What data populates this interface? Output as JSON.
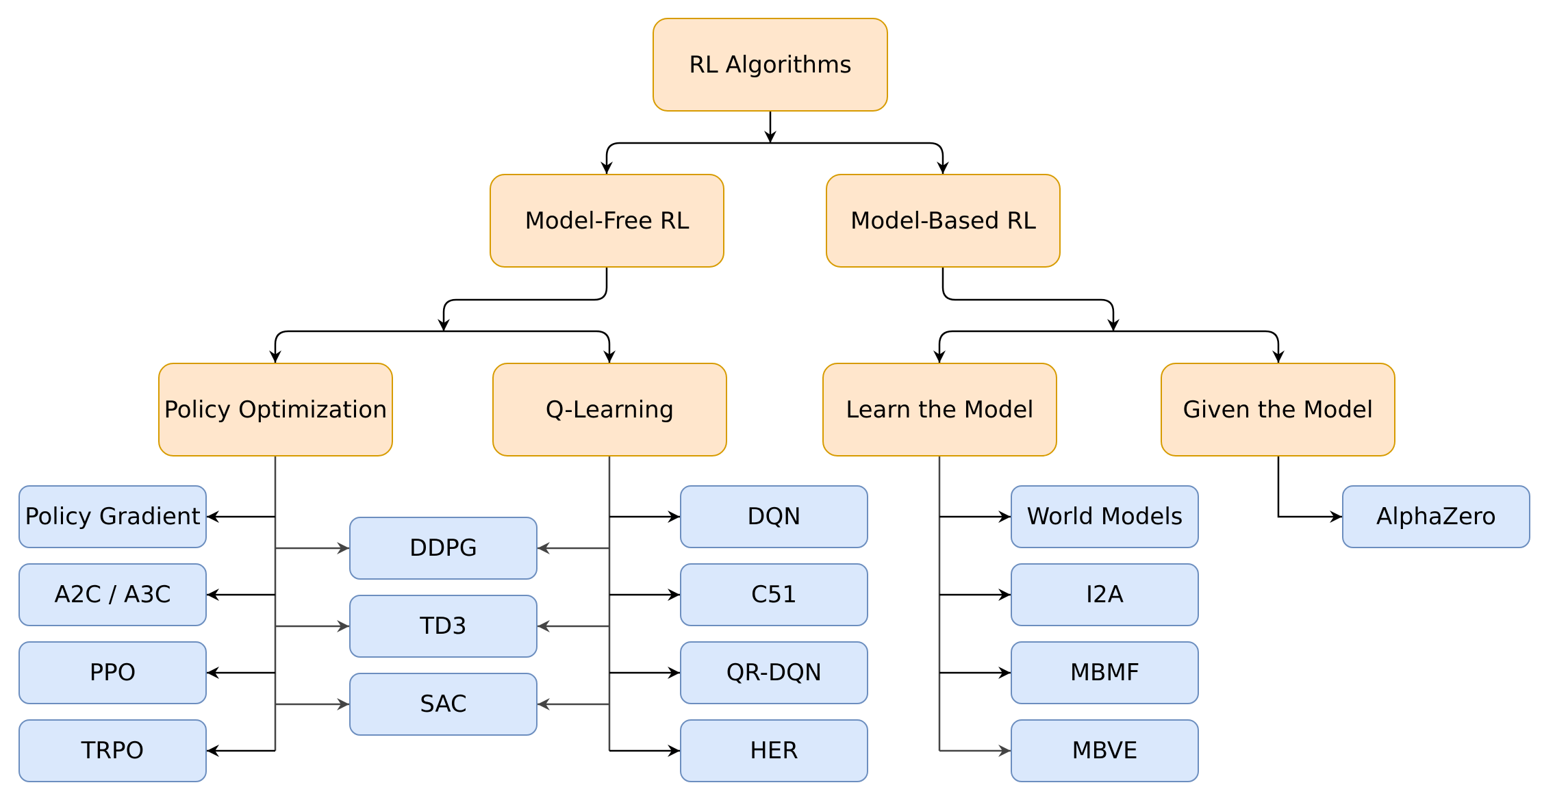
{
  "diagram": {
    "root": {
      "id": "rl",
      "label": "RL Algorithms"
    },
    "level1": [
      {
        "id": "mf",
        "label": "Model-Free RL"
      },
      {
        "id": "mb",
        "label": "Model-Based RL"
      }
    ],
    "level2": [
      {
        "id": "po",
        "label": "Policy Optimization",
        "parent": "mf"
      },
      {
        "id": "ql",
        "label": "Q-Learning",
        "parent": "mf"
      },
      {
        "id": "lm",
        "label": "Learn the Model",
        "parent": "mb"
      },
      {
        "id": "gm",
        "label": "Given the Model",
        "parent": "mb"
      }
    ],
    "algorithms": {
      "policy_optimization_only": [
        "Policy Gradient",
        "A2C / A3C",
        "PPO",
        "TRPO"
      ],
      "both_policy_and_q": [
        "DDPG",
        "TD3",
        "SAC"
      ],
      "q_learning_only": [
        "DQN",
        "C51",
        "QR-DQN",
        "HER"
      ],
      "learn_the_model": [
        "World Models",
        "I2A",
        "MBMF",
        "MBVE"
      ],
      "given_the_model": [
        "AlphaZero"
      ]
    },
    "colors": {
      "category_fill": "#ffe6cc",
      "category_stroke": "#d79b00",
      "algorithm_fill": "#dae8fc",
      "algorithm_stroke": "#6c8ebf",
      "edge_dark": "#000000",
      "edge_gray": "#444444"
    }
  }
}
